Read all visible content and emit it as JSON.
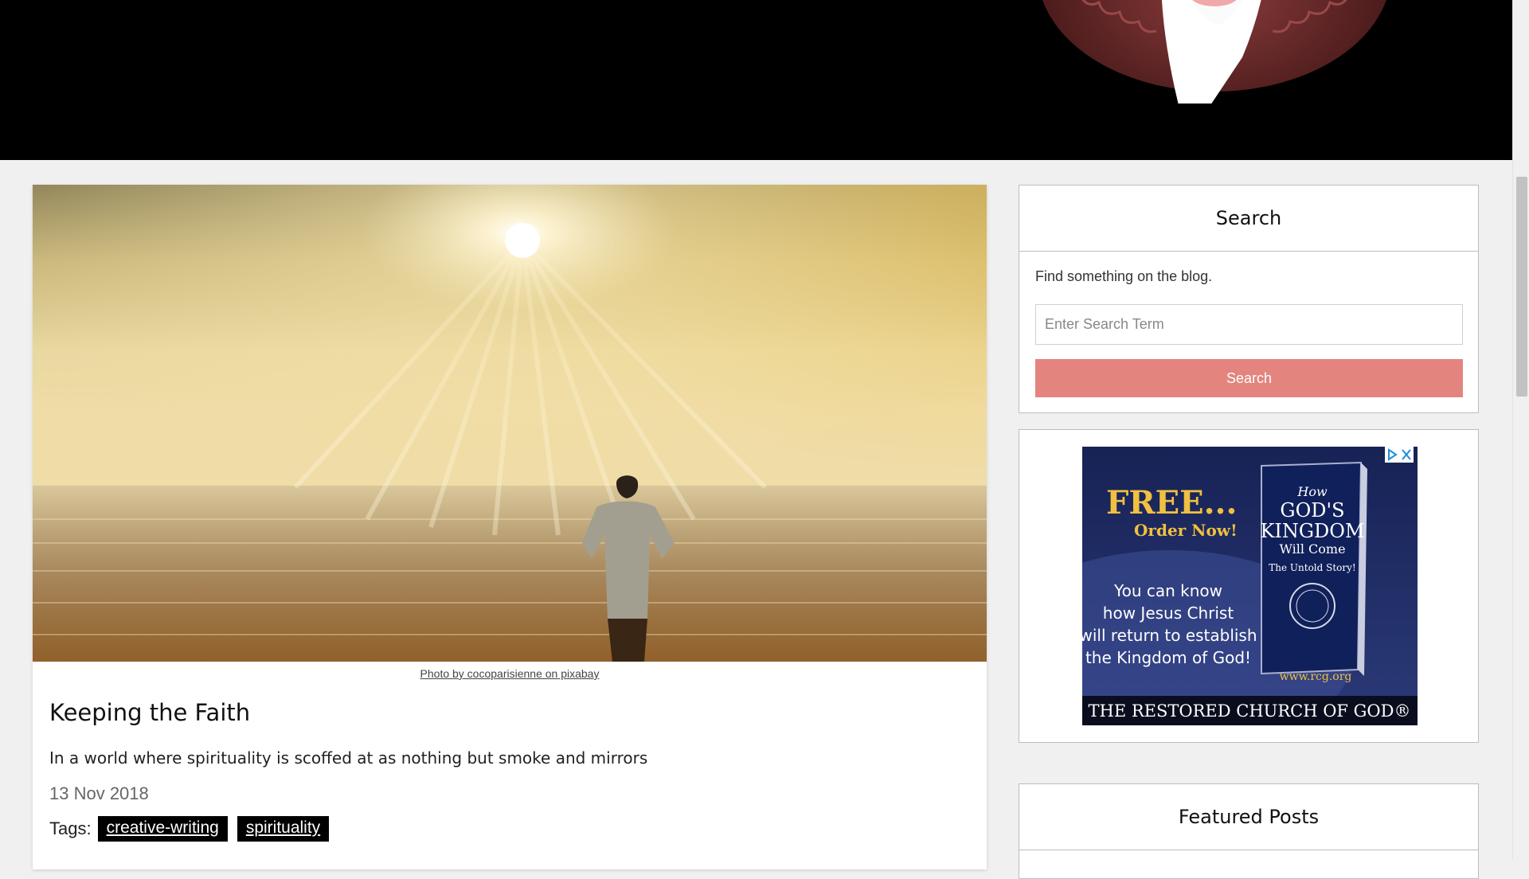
{
  "post": {
    "photo_credit": "Photo by cocoparisienne on pixabay",
    "title": "Keeping the Faith",
    "excerpt": "In a world where spirituality is scoffed at as nothing but smoke and mirrors",
    "date": "13 Nov 2018",
    "tags_label": "Tags:",
    "tags": [
      "creative-writing",
      "spirituality"
    ]
  },
  "sidebar": {
    "search": {
      "title": "Search",
      "description": "Find something on the blog.",
      "placeholder": "Enter Search Term",
      "button_label": "Search"
    },
    "ad": {
      "free_text": "FREE...",
      "order_text": "Order Now!",
      "book_title_line1": "How",
      "book_title_line2": "GOD'S",
      "book_title_line3": "KINGDOM",
      "book_title_line4": "Will Come",
      "book_subtitle": "The Untold Story!",
      "body_line1": "You can know",
      "body_line2": "how Jesus Christ",
      "body_line3": "will return to establish",
      "body_line4": "the Kingdom of God!",
      "url": "www.rcg.org",
      "footer": "THE RESTORED CHURCH OF GOD®"
    },
    "featured": {
      "title": "Featured Posts"
    }
  },
  "colors": {
    "header_bg": "#000000",
    "search_button": "#e4847e",
    "ad_bg": "#1e2a5e",
    "ad_gold": "#f0c040",
    "tag_bg": "#000000"
  }
}
